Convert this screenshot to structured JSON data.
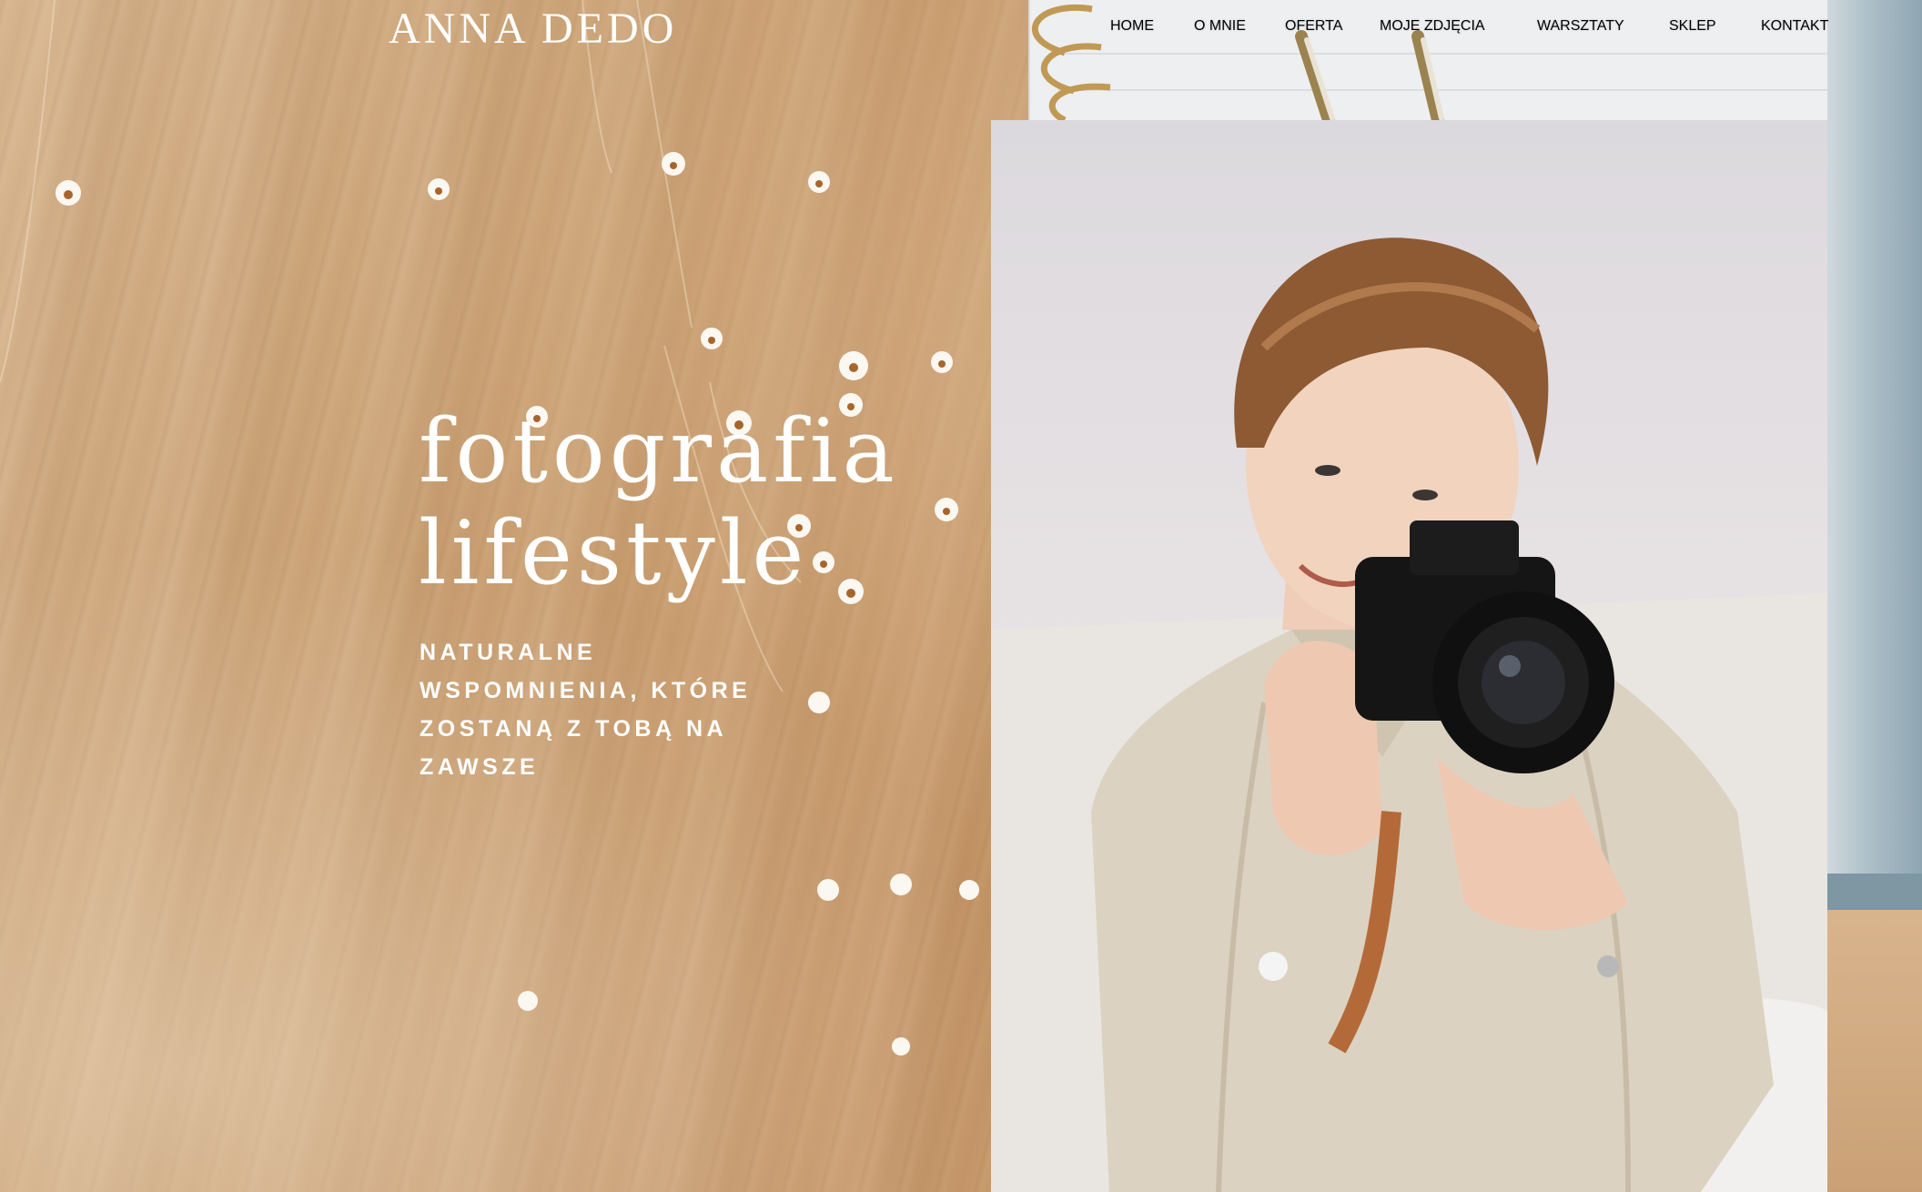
{
  "header": {
    "logo": "ANNA DEDO",
    "nav": [
      {
        "label": "HOME",
        "name": "nav-home"
      },
      {
        "label": "O MNIE",
        "name": "nav-o-mnie"
      },
      {
        "label": "OFERTA",
        "name": "nav-oferta"
      },
      {
        "label": "MOJE ZDJĘCIA",
        "name": "nav-moje-zdjecia"
      },
      {
        "label": "WARSZTATY",
        "name": "nav-warsztaty"
      },
      {
        "label": "SKLEP",
        "name": "nav-sklep"
      },
      {
        "label": "KONTAKT",
        "name": "nav-kontakt"
      }
    ]
  },
  "hero": {
    "title_lines": [
      "fotografia",
      "lifestyle"
    ],
    "subtitle_lines": [
      "NATURALNE",
      "WSPOMNIENIA, KTÓRE",
      "ZOSTANĄ Z TOBĄ NA",
      "ZAWSZE"
    ]
  },
  "colors": {
    "text": "#ffffff",
    "wood": "#c89d6f",
    "photo_background": "#e4e0e1"
  }
}
